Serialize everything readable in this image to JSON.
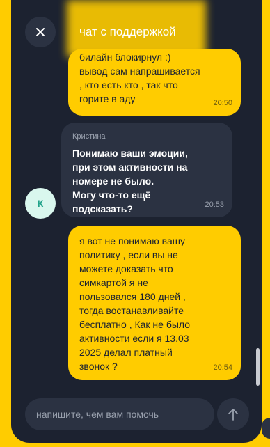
{
  "header": {
    "title": "чат с поддержкой",
    "close_icon": "close-icon"
  },
  "messages": [
    {
      "sender": "user",
      "text": "билайн  блокирнул :)\nвывод сам напрашивается\n, кто есть кто ,  так что\nгорите в аду",
      "time": "20:50"
    },
    {
      "sender": "operator",
      "name": "Кристина",
      "text": "Понимаю ваши эмоции,\nпри этом активности на\nномере не было.\nМогу что-то ещё\nподсказать?",
      "time": "20:53",
      "avatar_letter": "К"
    },
    {
      "sender": "user",
      "text": "я вот не понимаю вашу\nполитику  , если вы не\nможете  доказать  что\nсимкартой я не\nпользовался  180  дней ,\nтогда востанавливайте\nбесплатно , Как не было\nактивности если я  13.03\n2025  делал платный\nзвонок ?",
      "time": "20:54"
    }
  ],
  "composer": {
    "placeholder": "напишите, чем вам помочь",
    "send_icon": "arrow-up-icon"
  },
  "colors": {
    "accent": "#ffcc00",
    "background": "#1c2230",
    "bubble_dark": "#2b3242",
    "avatar_bg": "#d9f7ee",
    "avatar_fg": "#21a38a"
  }
}
